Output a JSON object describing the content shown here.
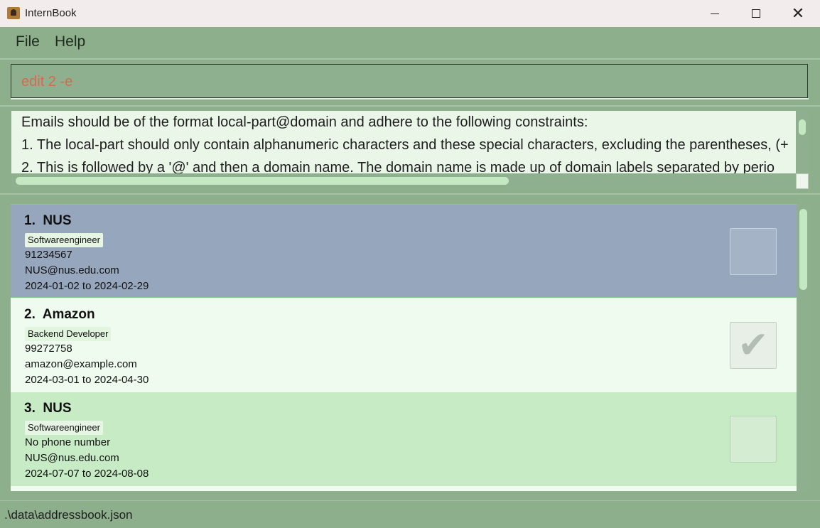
{
  "window": {
    "title": "InternBook",
    "minimize_icon": "minimize-icon",
    "maximize_icon": "maximize-icon",
    "close_icon": "close-icon",
    "close_glyph": "✕"
  },
  "menu": {
    "file": "File",
    "help": "Help"
  },
  "command": {
    "value": "edit 2 -e",
    "text_color": "#d46a4f"
  },
  "result": {
    "lines": [
      "Emails should be of the format local-part@domain and adhere to the following constraints:",
      "1. The local-part should only contain alphanumeric characters and these special characters, excluding the parentheses, (+",
      "2. This is followed by a '@' and then a domain name. The domain name is made up of domain labels separated by perio"
    ]
  },
  "cards": [
    {
      "index": "1.",
      "company": "NUS",
      "role": "Softwareengineer",
      "phone": "91234567",
      "email": "NUS@nus.edu.com",
      "period": "2024-01-02 to 2024-02-29",
      "checked": false,
      "selected": true,
      "bg": "#96a6bd"
    },
    {
      "index": "2.",
      "company": "Amazon",
      "role": "Backend Developer",
      "phone": "99272758",
      "email": "amazon@example.com",
      "period": "2024-03-01 to 2024-04-30",
      "checked": true,
      "selected": false,
      "bg": "#f0fbef"
    },
    {
      "index": "3.",
      "company": "NUS",
      "role": "Softwareengineer",
      "phone": "No phone number",
      "email": "NUS@nus.edu.com",
      "period": "2024-07-07 to 2024-08-08",
      "checked": false,
      "selected": false,
      "bg": "#c6ebc5"
    }
  ],
  "checkmark_glyph": "✔",
  "status": {
    "path": ".\\data\\addressbook.json"
  },
  "colors": {
    "background": "#8daf8c",
    "accent": "#c4e8c1"
  }
}
